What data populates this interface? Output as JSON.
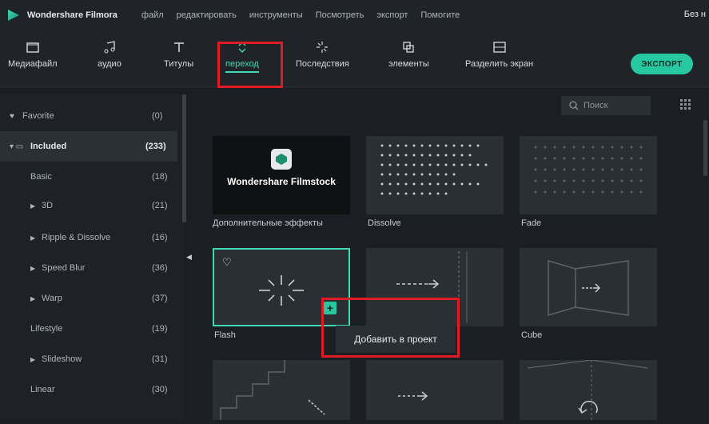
{
  "app": {
    "name": "Wondershare Filmora",
    "window_title": "Без н"
  },
  "menu": [
    "файл",
    "редактировать",
    "инструменты",
    "Посмотреть",
    "экспорт",
    "Помогите"
  ],
  "toolbar": {
    "tools": [
      {
        "label": "Медиафайл",
        "icon": "folder-icon"
      },
      {
        "label": "аудио",
        "icon": "music-note-icon"
      },
      {
        "label": "Титулы",
        "icon": "text-icon"
      },
      {
        "label": "переход",
        "icon": "transition-icon",
        "active": true
      },
      {
        "label": "Последствия",
        "icon": "effects-icon"
      },
      {
        "label": "элементы",
        "icon": "elements-icon"
      },
      {
        "label": "Разделить экран",
        "icon": "split-screen-icon"
      }
    ],
    "export_label": "ЭКСПОРТ",
    "accent": "#27c7a2",
    "highlight": "#e01b24"
  },
  "sidebar": {
    "items": [
      {
        "label": "Favorite",
        "count": "(0)"
      },
      {
        "label": "Included",
        "count": "(233)",
        "selected": true
      },
      {
        "label": "Basic",
        "count": "(18)"
      },
      {
        "label": "3D",
        "count": "(21)"
      },
      {
        "label": "Ripple & Dissolve",
        "count": "(16)"
      },
      {
        "label": "Speed Blur",
        "count": "(36)"
      },
      {
        "label": "Warp",
        "count": "(37)"
      },
      {
        "label": "Lifestyle",
        "count": "(19)"
      },
      {
        "label": "Slideshow",
        "count": "(31)"
      },
      {
        "label": "Linear",
        "count": "(30)"
      }
    ]
  },
  "search": {
    "placeholder": "Поиск"
  },
  "grid": {
    "items": [
      {
        "caption": "Дополнительные эффекты",
        "thumb_text": "Wondershare Filmstock"
      },
      {
        "caption": "Dissolve"
      },
      {
        "caption": "Fade"
      },
      {
        "caption": "Flash"
      },
      {
        "caption": ""
      },
      {
        "caption": "Cube"
      }
    ],
    "add_tooltip": "Добавить в проект"
  }
}
